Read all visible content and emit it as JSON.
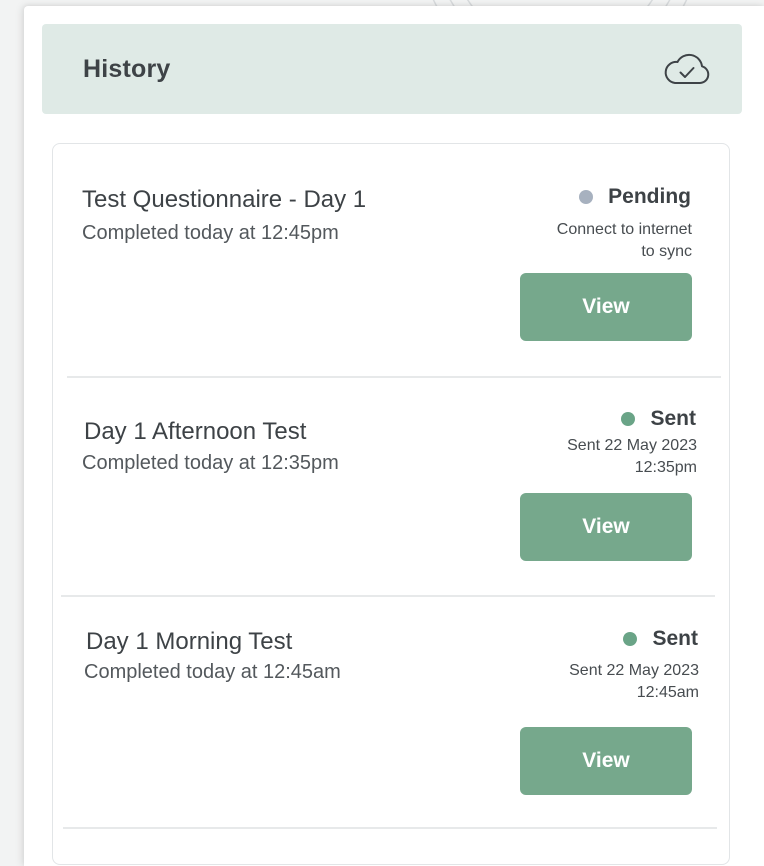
{
  "history": {
    "title": "History",
    "sync_icon": "cloud-check-icon"
  },
  "entries": [
    {
      "title": "Test Questionnaire - Day 1",
      "completed": "Completed today at 12:45pm",
      "status": "Pending",
      "status_color": "#a7b1bf",
      "note_line1": "Connect to internet",
      "note_line2": "to sync",
      "button": "View"
    },
    {
      "title": "Day 1 Afternoon Test",
      "completed": "Completed today at 12:35pm",
      "status": "Sent",
      "status_color": "#6aa487",
      "note_line1": "Sent 22 May 2023",
      "note_line2": "12:35pm",
      "button": "View"
    },
    {
      "title": "Day 1 Morning Test",
      "completed": "Completed today at 12:45am",
      "status": "Sent",
      "status_color": "#6aa487",
      "note_line1": "Sent 22 May 2023",
      "note_line2": "12:45am",
      "button": "View"
    }
  ],
  "colors": {
    "header_bg": "#dfeae6",
    "button": "#76a88c",
    "pending": "#a7b1bf",
    "sent": "#6aa487"
  }
}
